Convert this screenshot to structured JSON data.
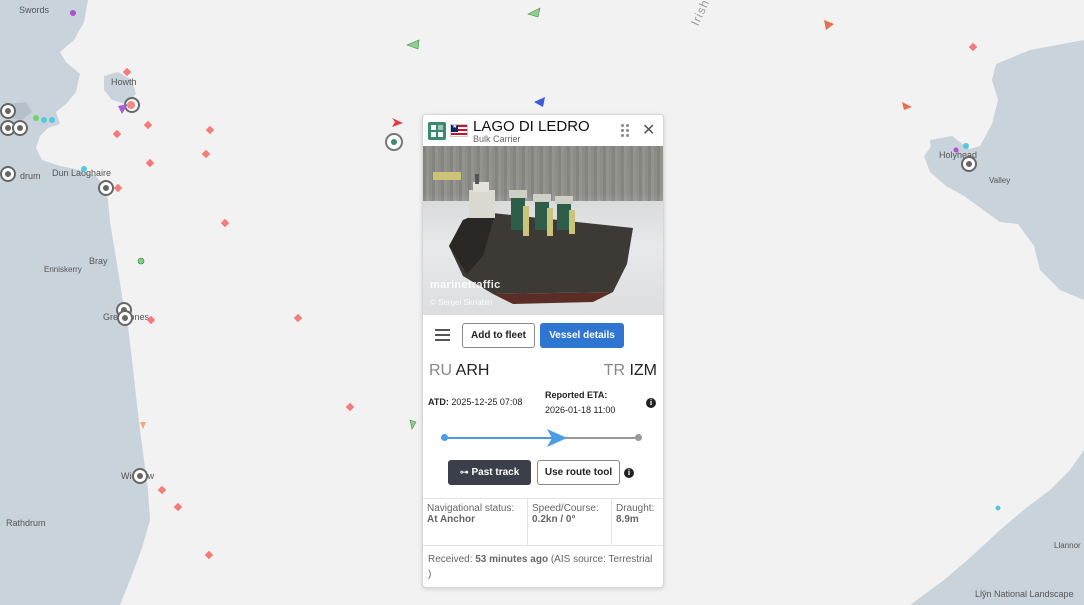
{
  "map": {
    "places": [
      "Swords",
      "Howth",
      "Dun Laoghaire",
      "Bray",
      "Enniskerry",
      "Greystones",
      "Wicklow",
      "Rathdrum",
      "Holyhead",
      "Valley",
      "Llannor",
      "Llŷn National Landscape",
      "drum"
    ],
    "sea_label": "Irish"
  },
  "vessel": {
    "name": "LAGO DI LEDRO",
    "type": "Bulk Carrier",
    "flag_icon": "liberia-flag-icon",
    "type_icon_color": "#3a8a6e",
    "photo_watermark": "marinetraffic",
    "photo_credit": "© Sergei Skriabin"
  },
  "actions": {
    "add_to_fleet": "Add to fleet",
    "vessel_details": "Vessel details"
  },
  "route": {
    "from_country": "RU",
    "from_port": "ARH",
    "to_country": "TR",
    "to_port": "IZM",
    "atd_label": "ATD:",
    "atd_value": "2025-12-25 07:08",
    "eta_label": "Reported ETA:",
    "eta_value": "2026-01-18 11:00",
    "progress": 0.6
  },
  "tools": {
    "past_track": "Past track",
    "route_tool": "Use route tool"
  },
  "status": {
    "nav_label": "Navigational status:",
    "nav_value": "At Anchor",
    "speed_label": "Speed/Course:",
    "speed_value": "0.2kn / 0°",
    "draught_label": "Draught:",
    "draught_value": "8.9m"
  },
  "received": {
    "label": "Received:",
    "value": "53 minutes ago",
    "source": "(AIS source: Terrestrial )"
  },
  "colors": {
    "land": "#c9d3dc",
    "sea": "#f2f2f2",
    "primary_button": "#2f76d2",
    "dark_button": "#3a3f4b",
    "progress": "#4a9be8"
  }
}
